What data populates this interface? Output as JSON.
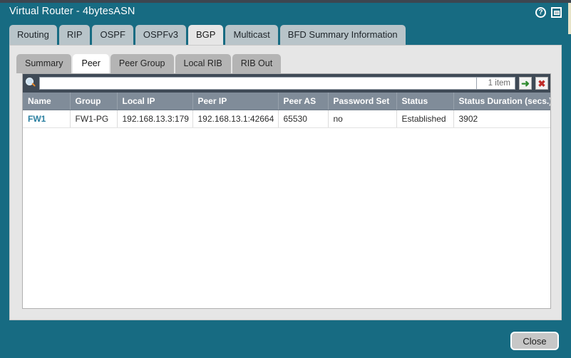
{
  "window": {
    "title": "Virtual Router - 4bytesASN",
    "help_icon": "help-circle-icon",
    "restore_icon": "restore-window-icon",
    "accent_color": "#176b82"
  },
  "tabs": [
    {
      "label": "Routing",
      "active": false
    },
    {
      "label": "RIP",
      "active": false
    },
    {
      "label": "OSPF",
      "active": false
    },
    {
      "label": "OSPFv3",
      "active": false
    },
    {
      "label": "BGP",
      "active": true
    },
    {
      "label": "Multicast",
      "active": false
    },
    {
      "label": "BFD Summary Information",
      "active": false
    }
  ],
  "subtabs": [
    {
      "label": "Summary",
      "active": false
    },
    {
      "label": "Peer",
      "active": true
    },
    {
      "label": "Peer Group",
      "active": false
    },
    {
      "label": "Local RIB",
      "active": false
    },
    {
      "label": "RIB Out",
      "active": false
    }
  ],
  "toolbar": {
    "search_icon": "search-icon",
    "search_value": "",
    "search_placeholder": "",
    "item_count": "1 item",
    "go_button_glyph": "➜",
    "clear_button_glyph": "✖"
  },
  "table": {
    "columns": [
      "Name",
      "Group",
      "Local IP",
      "Peer IP",
      "Peer AS",
      "Password Set",
      "Status",
      "Status Duration (secs.)"
    ],
    "rows": [
      {
        "name": "FW1",
        "group": "FW1-PG",
        "local_ip": "192.168.13.3:179",
        "peer_ip": "192.168.13.1:42664",
        "peer_as": "65530",
        "password_set": "no",
        "status": "Established",
        "status_duration": "3902"
      }
    ],
    "link_color": "#2a7fa0"
  },
  "footer": {
    "close_label": "Close"
  }
}
